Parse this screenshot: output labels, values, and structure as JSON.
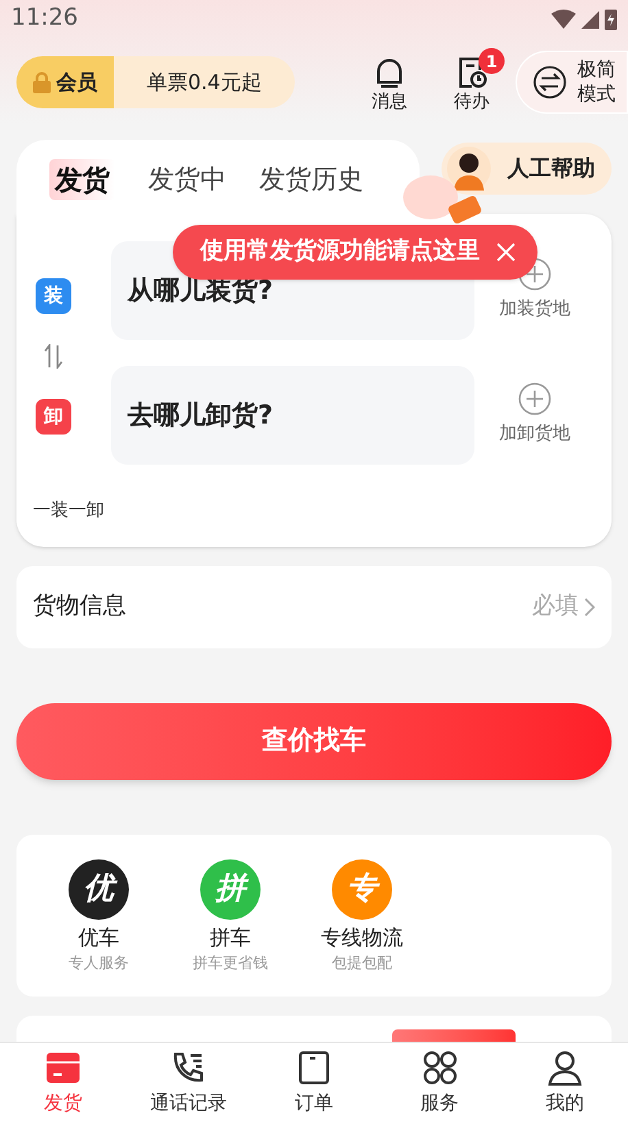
{
  "status_bar": {
    "time": "11:26"
  },
  "header": {
    "member": {
      "label": "会员",
      "offer": "单票0.4元起"
    },
    "actions": [
      {
        "kind": "bell",
        "label": "消息"
      },
      {
        "kind": "todo",
        "label": "待办",
        "badge": "1"
      }
    ],
    "mode_button": {
      "lines": [
        "极简",
        "模式"
      ]
    }
  },
  "tabs": [
    {
      "label": "发货",
      "selected": true
    },
    {
      "label": "发货中",
      "selected": false
    },
    {
      "label": "发货历史",
      "selected": false
    }
  ],
  "help_button": {
    "label": "人工帮助"
  },
  "route": {
    "stops": [
      {
        "tag": "装",
        "color": "#2d8cf0",
        "placeholder": "从哪儿装货?",
        "add_label": "加装货地"
      },
      {
        "tag": "卸",
        "color": "#f5424a",
        "placeholder": "去哪儿卸货?",
        "add_label": "加卸货地"
      }
    ],
    "summary": "一装一卸"
  },
  "tooltip": {
    "text": "使用常发货源功能请点这里"
  },
  "cargo": {
    "label": "货物信息",
    "placeholder": "必填"
  },
  "search_button": {
    "label": "查价找车"
  },
  "services": [
    {
      "glyph": "优",
      "color": "#222222",
      "title": "优车",
      "subtitle": "专人服务"
    },
    {
      "glyph": "拼",
      "color": "#2fbf4a",
      "title": "拼车",
      "subtitle": "拼车更省钱"
    },
    {
      "glyph": "专",
      "color": "#ff8a00",
      "title": "专线物流",
      "subtitle": "包提包配"
    }
  ],
  "bottom_nav": [
    {
      "kind": "box",
      "label": "发货",
      "selected": true
    },
    {
      "kind": "phone",
      "label": "通话记录",
      "selected": false
    },
    {
      "kind": "order",
      "label": "订单",
      "selected": false
    },
    {
      "kind": "grid",
      "label": "服务",
      "selected": false
    },
    {
      "kind": "user",
      "label": "我的",
      "selected": false
    }
  ]
}
